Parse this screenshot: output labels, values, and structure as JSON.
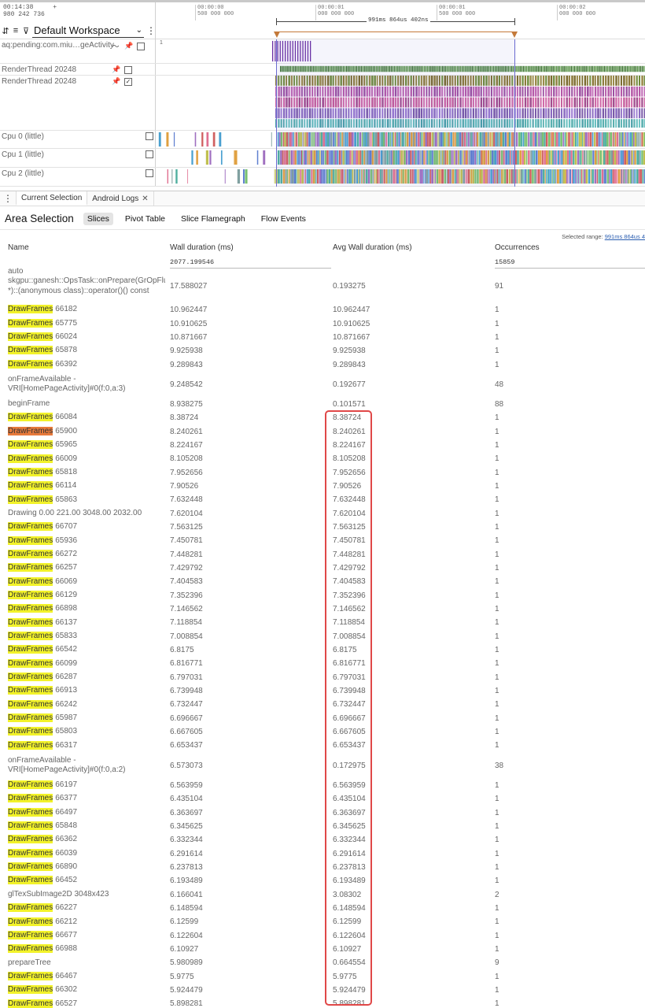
{
  "timeline": {
    "time_left": [
      "00:14:38",
      "980 242 736"
    ],
    "plus_sign": "+",
    "workspace": "Default Workspace",
    "ticks": [
      {
        "l1": "00:00:00",
        "l2": "500 000 000"
      },
      {
        "l1": "00:00:01",
        "l2": "000 000 000"
      },
      {
        "l1": "00:00:01",
        "l2": "500 000 000"
      },
      {
        "l1": "00:00:02",
        "l2": "000 000 000"
      }
    ],
    "range_label": "991ms 864us 402ns"
  },
  "tracks": [
    {
      "label": "aq:pending:com.miu…geActivity",
      "pinned": true,
      "checked": false,
      "marker": "1"
    },
    {
      "label": "RenderThread 20248",
      "pinned": true,
      "checked": false
    },
    {
      "label": "RenderThread 20248",
      "pinned": true,
      "checked": true
    },
    {
      "label": "Cpu 0 (little)",
      "checked": false
    },
    {
      "label": "Cpu 1 (little)",
      "checked": false
    },
    {
      "label": "Cpu 2 (little)",
      "checked": false
    }
  ],
  "panel": {
    "tabs": [
      {
        "label": "Current Selection"
      },
      {
        "label": "Android Logs"
      }
    ],
    "close_glyph": "✕",
    "title": "Area Selection",
    "subtabs": [
      "Slices",
      "Pivot Table",
      "Slice Flamegraph",
      "Flow Events"
    ],
    "selected_range_prefix": "Selected range: ",
    "selected_range_value": "991ms 864us 4",
    "columns": {
      "name": "Name",
      "wall": "Wall duration (ms)",
      "avg": "Avg Wall duration (ms)",
      "occ": "Occurrences"
    },
    "totals": {
      "wall": "2077.199546",
      "occ": "15859"
    }
  },
  "rows": [
    {
      "name": "auto skgpu::ganesh::OpsTask::onPrepare(GrOpFlushState *)::(anonymous class)::operator()() const",
      "wall": "17.588027",
      "avg": "0.193275",
      "occ": "91",
      "tall": 3
    },
    {
      "hl": "DrawFrames",
      "id": "66182",
      "wall": "10.962447",
      "avg": "10.962447",
      "occ": "1"
    },
    {
      "hl": "DrawFrames",
      "id": "65775",
      "wall": "10.910625",
      "avg": "10.910625",
      "occ": "1"
    },
    {
      "hl": "DrawFrames",
      "id": "66024",
      "wall": "10.871667",
      "avg": "10.871667",
      "occ": "1"
    },
    {
      "hl": "DrawFrames",
      "id": "65878",
      "wall": "9.925938",
      "avg": "9.925938",
      "occ": "1"
    },
    {
      "hl": "DrawFrames",
      "id": "66392",
      "wall": "9.289843",
      "avg": "9.289843",
      "occ": "1"
    },
    {
      "name": "onFrameAvailable - VRI[HomePageActivity]#0(f:0,a:3)",
      "wall": "9.248542",
      "avg": "0.192677",
      "occ": "48",
      "tall": 2
    },
    {
      "name": "beginFrame",
      "wall": "8.938275",
      "avg": "0.101571",
      "occ": "88"
    },
    {
      "hl": "DrawFrames",
      "id": "66084",
      "wall": "8.38724",
      "avg": "8.38724",
      "occ": "1"
    },
    {
      "hl": "DrawFrames",
      "id": "65900",
      "wall": "8.240261",
      "avg": "8.240261",
      "occ": "1",
      "orange": true
    },
    {
      "hl": "DrawFrames",
      "id": "65965",
      "wall": "8.224167",
      "avg": "8.224167",
      "occ": "1"
    },
    {
      "hl": "DrawFrames",
      "id": "66009",
      "wall": "8.105208",
      "avg": "8.105208",
      "occ": "1"
    },
    {
      "hl": "DrawFrames",
      "id": "65818",
      "wall": "7.952656",
      "avg": "7.952656",
      "occ": "1"
    },
    {
      "hl": "DrawFrames",
      "id": "66114",
      "wall": "7.90526",
      "avg": "7.90526",
      "occ": "1"
    },
    {
      "hl": "DrawFrames",
      "id": "65863",
      "wall": "7.632448",
      "avg": "7.632448",
      "occ": "1"
    },
    {
      "name": "Drawing 0.00 221.00 3048.00 2032.00",
      "wall": "7.620104",
      "avg": "7.620104",
      "occ": "1"
    },
    {
      "hl": "DrawFrames",
      "id": "66707",
      "wall": "7.563125",
      "avg": "7.563125",
      "occ": "1"
    },
    {
      "hl": "DrawFrames",
      "id": "65936",
      "wall": "7.450781",
      "avg": "7.450781",
      "occ": "1"
    },
    {
      "hl": "DrawFrames",
      "id": "66272",
      "wall": "7.448281",
      "avg": "7.448281",
      "occ": "1"
    },
    {
      "hl": "DrawFrames",
      "id": "66257",
      "wall": "7.429792",
      "avg": "7.429792",
      "occ": "1"
    },
    {
      "hl": "DrawFrames",
      "id": "66069",
      "wall": "7.404583",
      "avg": "7.404583",
      "occ": "1"
    },
    {
      "hl": "DrawFrames",
      "id": "66129",
      "wall": "7.352396",
      "avg": "7.352396",
      "occ": "1"
    },
    {
      "hl": "DrawFrames",
      "id": "66898",
      "wall": "7.146562",
      "avg": "7.146562",
      "occ": "1"
    },
    {
      "hl": "DrawFrames",
      "id": "66137",
      "wall": "7.118854",
      "avg": "7.118854",
      "occ": "1"
    },
    {
      "hl": "DrawFrames",
      "id": "65833",
      "wall": "7.008854",
      "avg": "7.008854",
      "occ": "1"
    },
    {
      "hl": "DrawFrames",
      "id": "66542",
      "wall": "6.8175",
      "avg": "6.8175",
      "occ": "1"
    },
    {
      "hl": "DrawFrames",
      "id": "66099",
      "wall": "6.816771",
      "avg": "6.816771",
      "occ": "1"
    },
    {
      "hl": "DrawFrames",
      "id": "66287",
      "wall": "6.797031",
      "avg": "6.797031",
      "occ": "1"
    },
    {
      "hl": "DrawFrames",
      "id": "66913",
      "wall": "6.739948",
      "avg": "6.739948",
      "occ": "1"
    },
    {
      "hl": "DrawFrames",
      "id": "66242",
      "wall": "6.732447",
      "avg": "6.732447",
      "occ": "1"
    },
    {
      "hl": "DrawFrames",
      "id": "65987",
      "wall": "6.696667",
      "avg": "6.696667",
      "occ": "1"
    },
    {
      "hl": "DrawFrames",
      "id": "65803",
      "wall": "6.667605",
      "avg": "6.667605",
      "occ": "1"
    },
    {
      "hl": "DrawFrames",
      "id": "66317",
      "wall": "6.653437",
      "avg": "6.653437",
      "occ": "1"
    },
    {
      "name": "onFrameAvailable - VRI[HomePageActivity]#0(f:0,a:2)",
      "wall": "6.573073",
      "avg": "0.172975",
      "occ": "38",
      "tall": 2
    },
    {
      "hl": "DrawFrames",
      "id": "66197",
      "wall": "6.563959",
      "avg": "6.563959",
      "occ": "1"
    },
    {
      "hl": "DrawFrames",
      "id": "66377",
      "wall": "6.435104",
      "avg": "6.435104",
      "occ": "1"
    },
    {
      "hl": "DrawFrames",
      "id": "66497",
      "wall": "6.363697",
      "avg": "6.363697",
      "occ": "1"
    },
    {
      "hl": "DrawFrames",
      "id": "65848",
      "wall": "6.345625",
      "avg": "6.345625",
      "occ": "1"
    },
    {
      "hl": "DrawFrames",
      "id": "66362",
      "wall": "6.332344",
      "avg": "6.332344",
      "occ": "1"
    },
    {
      "hl": "DrawFrames",
      "id": "66039",
      "wall": "6.291614",
      "avg": "6.291614",
      "occ": "1"
    },
    {
      "hl": "DrawFrames",
      "id": "66890",
      "wall": "6.237813",
      "avg": "6.237813",
      "occ": "1"
    },
    {
      "hl": "DrawFrames",
      "id": "66452",
      "wall": "6.193489",
      "avg": "6.193489",
      "occ": "1"
    },
    {
      "name": "glTexSubImage2D 3048x423",
      "wall": "6.166041",
      "avg": "3.08302",
      "occ": "2"
    },
    {
      "hl": "DrawFrames",
      "id": "66227",
      "wall": "6.148594",
      "avg": "6.148594",
      "occ": "1"
    },
    {
      "hl": "DrawFrames",
      "id": "66212",
      "wall": "6.12599",
      "avg": "6.12599",
      "occ": "1"
    },
    {
      "hl": "DrawFrames",
      "id": "66677",
      "wall": "6.122604",
      "avg": "6.122604",
      "occ": "1"
    },
    {
      "hl": "DrawFrames",
      "id": "66988",
      "wall": "6.10927",
      "avg": "6.10927",
      "occ": "1"
    },
    {
      "name": "prepareTree",
      "wall": "5.980989",
      "avg": "0.664554",
      "occ": "9"
    },
    {
      "hl": "DrawFrames",
      "id": "66467",
      "wall": "5.9775",
      "avg": "5.9775",
      "occ": "1"
    },
    {
      "hl": "DrawFrames",
      "id": "66302",
      "wall": "5.924479",
      "avg": "5.924479",
      "occ": "1"
    },
    {
      "hl": "DrawFrames",
      "id": "66527",
      "wall": "5.898281",
      "avg": "5.898281",
      "occ": "1"
    }
  ],
  "colors": {
    "highlight": "#f2f22a",
    "highlight_selected": "#e77a3c",
    "annotation_box": "#e04848",
    "range_marker": "#c47a3a"
  }
}
